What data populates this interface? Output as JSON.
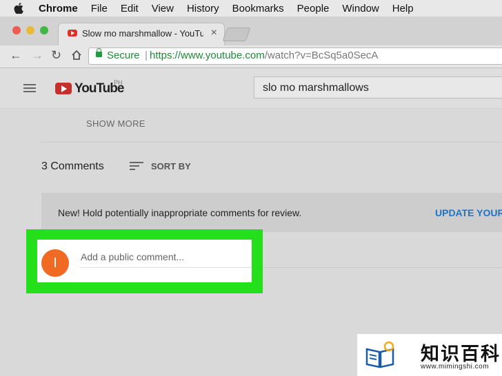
{
  "menubar": {
    "app_name": "Chrome",
    "items": [
      "File",
      "Edit",
      "View",
      "History",
      "Bookmarks",
      "People",
      "Window",
      "Help"
    ]
  },
  "tab": {
    "title": "Slow mo marshmallow - YouTube",
    "close": "×"
  },
  "address": {
    "secure_label": "Secure",
    "url_host": "https://www.youtube.com",
    "url_path": "/watch?v=BcSq5a0SecA"
  },
  "youtube": {
    "logo_text": "YouTube",
    "region": "PH",
    "search_query": "slo mo marshmallows"
  },
  "comments": {
    "show_more": "SHOW MORE",
    "count_label": "3 Comments",
    "sort_label": "SORT BY",
    "notice_text": "New! Hold potentially inappropriate comments for review.",
    "notice_action": "UPDATE YOUR",
    "avatar_initial": "I",
    "input_placeholder": "Add a public comment..."
  },
  "watermark": {
    "chinese": "知识百科",
    "domain": "www.mimingshi.com"
  },
  "colors": {
    "highlight": "#24e01b",
    "avatar": "#f06a24",
    "secure_green": "#1e8a35",
    "link_blue": "#1f73c4",
    "youtube_red": "#c4302b"
  },
  "icons": [
    "apple-icon",
    "youtube-favicon",
    "back-icon",
    "forward-icon",
    "reload-icon",
    "home-icon",
    "lock-icon",
    "hamburger-icon",
    "sort-icon",
    "book-lightbulb-icon"
  ]
}
